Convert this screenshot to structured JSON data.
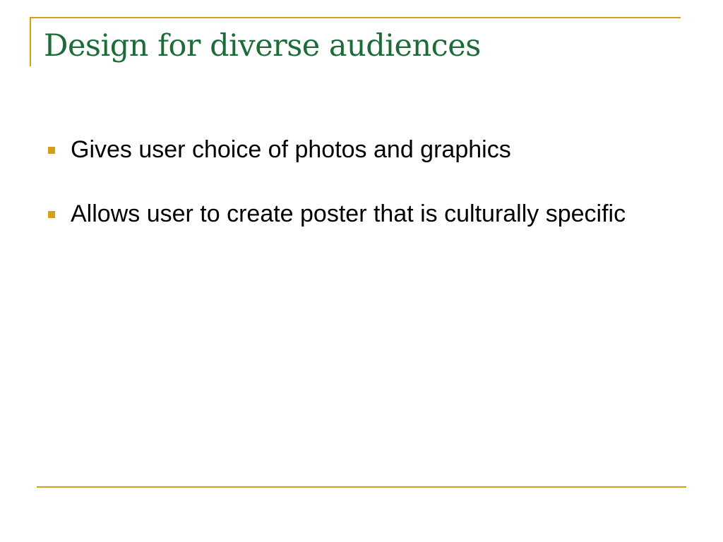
{
  "slide": {
    "title": "Design for diverse audiences",
    "bullets": [
      "Gives user choice of photos and graphics",
      "Allows user to create poster that is culturally specific"
    ]
  },
  "colors": {
    "accent": "#d4a017",
    "title": "#1e6b3a",
    "body_text": "#000000",
    "background": "#ffffff"
  }
}
